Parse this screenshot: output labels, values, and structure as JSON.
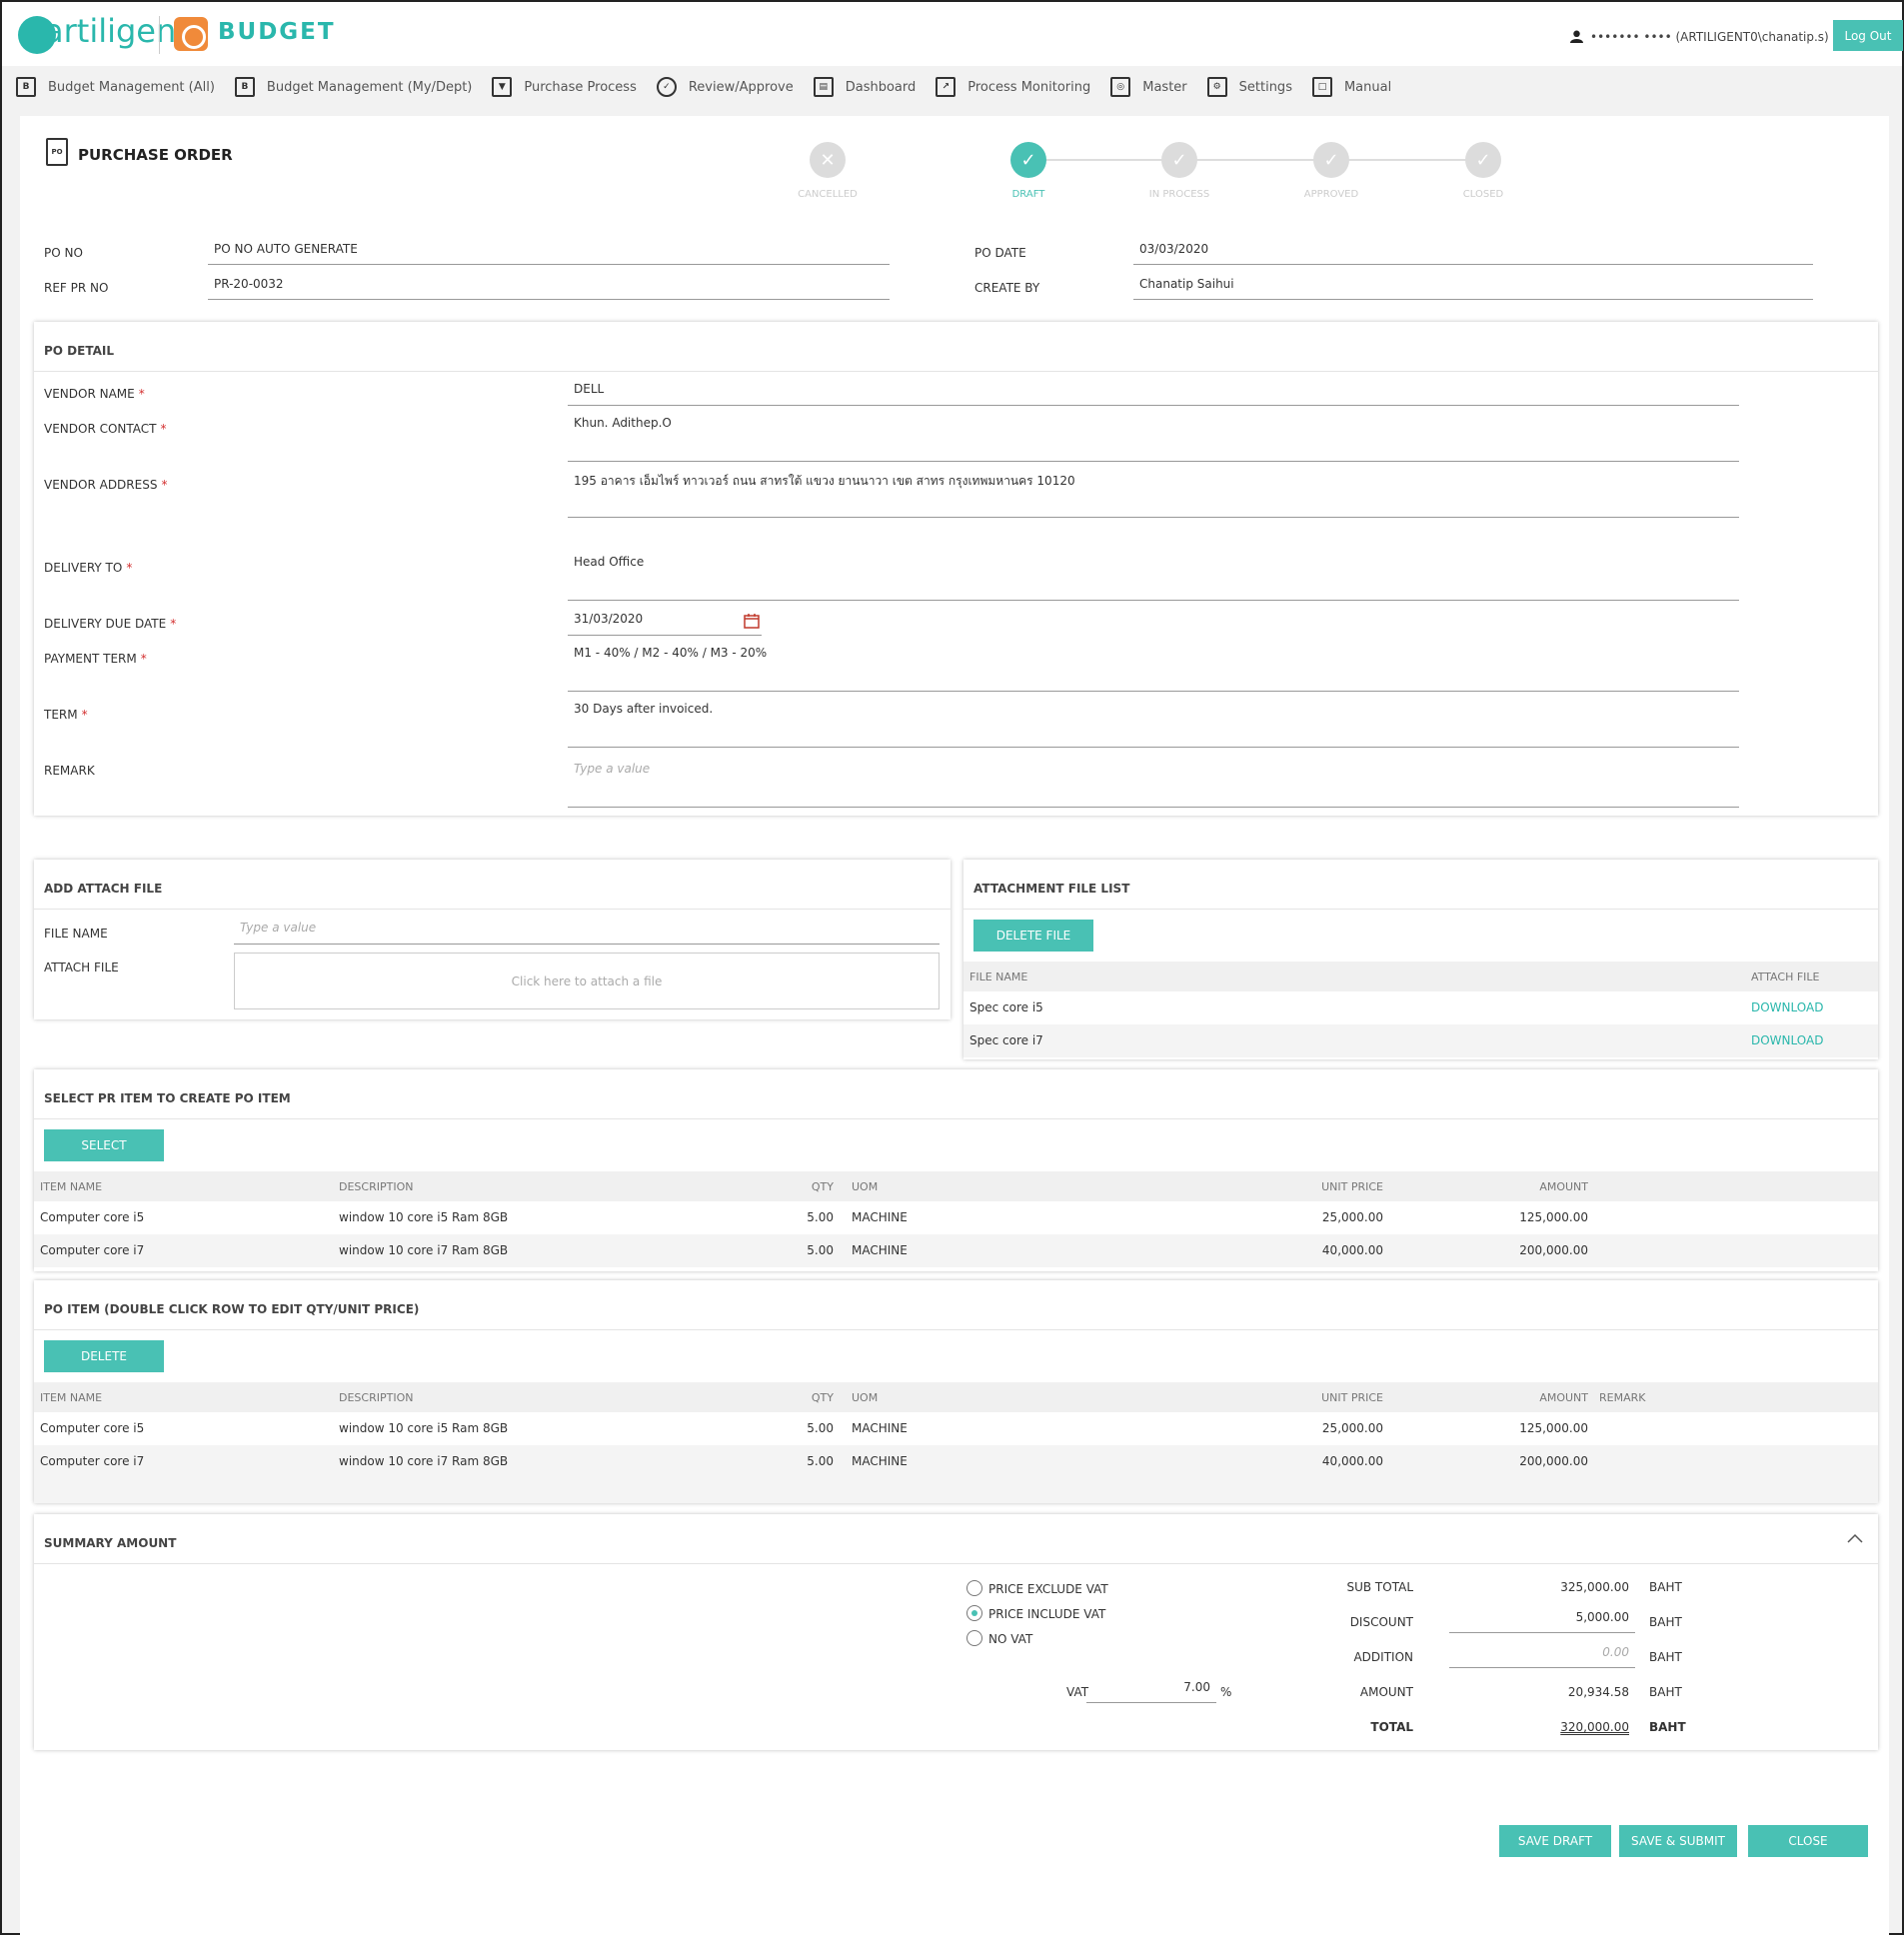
{
  "header": {
    "logo": "artiligent",
    "app": "BUDGET",
    "user": "••••••• •••• (ARTILIGENT0\\chanatip.s)",
    "logout": "Log Out"
  },
  "menu": [
    {
      "label": "Budget Management (All)",
      "icon": "B"
    },
    {
      "label": "Budget Management (My/Dept)",
      "icon": "B"
    },
    {
      "label": "Purchase Process",
      "icon": "▼"
    },
    {
      "label": "Review/Approve",
      "icon": "✓"
    },
    {
      "label": "Dashboard",
      "icon": "▤"
    },
    {
      "label": "Process Monitoring",
      "icon": "↗"
    },
    {
      "label": "Master",
      "icon": "◎"
    },
    {
      "label": "Settings",
      "icon": "⚙"
    },
    {
      "label": "Manual",
      "icon": "□"
    }
  ],
  "page": {
    "icon": "PO",
    "title": "PURCHASE ORDER"
  },
  "steps": [
    "CANCELLED",
    "DRAFT",
    "IN PROCESS",
    "APPROVED",
    "CLOSED"
  ],
  "steps_active": "DRAFT",
  "head": {
    "po_no_label": "PO NO",
    "po_no": "PO NO AUTO GENERATE",
    "ref_pr_label": "REF PR NO",
    "ref_pr": "PR-20-0032",
    "po_date_label": "PO DATE",
    "po_date": "03/03/2020",
    "create_by_label": "CREATE BY",
    "create_by": "Chanatip Saihui"
  },
  "detail": {
    "title": "PO DETAIL",
    "vendor_name_label": "VENDOR NAME",
    "vendor_name": "DELL",
    "vendor_contact_label": "VENDOR CONTACT",
    "vendor_contact": "Khun. Adithep.O",
    "vendor_address_label": "VENDOR ADDRESS",
    "vendor_address": "195 อาคาร เอ็มไพร์ ทาวเวอร์ ถนน สาทรใต้ แขวง ยานนาวา เขต สาทร กรุงเทพมหานคร 10120",
    "delivery_to_label": "DELIVERY TO",
    "delivery_to": "Head Office",
    "due_date_label": "DELIVERY DUE DATE",
    "due_date": "31/03/2020",
    "payment_term_label": "PAYMENT TERM",
    "payment_term": "M1 - 40% / M2 - 40% / M3 - 20%",
    "term_label": "TERM",
    "term": "30 Days after invoiced.",
    "remark_label": "REMARK",
    "remark_placeholder": "Type a value"
  },
  "attach": {
    "title": "ADD ATTACH FILE",
    "file_name_label": "FILE NAME",
    "file_name_placeholder": "Type a value",
    "attach_label": "ATTACH FILE",
    "drop_text": "Click here to attach a file"
  },
  "files": {
    "title": "ATTACHMENT FILE LIST",
    "delete_btn": "DELETE FILE",
    "col_name": "FILE NAME",
    "col_attach": "ATTACH FILE",
    "rows": [
      {
        "name": "Spec core i5",
        "link": "DOWNLOAD"
      },
      {
        "name": "Spec core i7",
        "link": "DOWNLOAD"
      }
    ]
  },
  "pr_items": {
    "title": "SELECT PR ITEM TO CREATE PO ITEM",
    "button": "SELECT",
    "cols": {
      "item": "ITEM NAME",
      "desc": "DESCRIPTION",
      "qty": "QTY",
      "uom": "UOM",
      "unit": "UNIT PRICE",
      "amount": "AMOUNT"
    },
    "rows": [
      {
        "item": "Computer core i5",
        "desc": "window 10 core i5 Ram 8GB",
        "qty": "5.00",
        "uom": "MACHINE",
        "unit": "25,000.00",
        "amount": "125,000.00"
      },
      {
        "item": "Computer core i7",
        "desc": "window 10 core i7 Ram 8GB",
        "qty": "5.00",
        "uom": "MACHINE",
        "unit": "40,000.00",
        "amount": "200,000.00"
      }
    ]
  },
  "po_items": {
    "title": "PO ITEM (DOUBLE CLICK ROW TO EDIT QTY/UNIT PRICE)",
    "button": "DELETE",
    "cols": {
      "item": "ITEM NAME",
      "desc": "DESCRIPTION",
      "qty": "QTY",
      "uom": "UOM",
      "unit": "UNIT PRICE",
      "amount": "AMOUNT",
      "remark": "REMARK"
    },
    "rows": [
      {
        "item": "Computer core i5",
        "desc": "window 10 core i5 Ram 8GB",
        "qty": "5.00",
        "uom": "MACHINE",
        "unit": "25,000.00",
        "amount": "125,000.00"
      },
      {
        "item": "Computer core i7",
        "desc": "window 10 core i7 Ram 8GB",
        "qty": "5.00",
        "uom": "MACHINE",
        "unit": "40,000.00",
        "amount": "200,000.00"
      }
    ]
  },
  "summary": {
    "title": "SUMMARY AMOUNT",
    "vat_options": [
      "PRICE EXCLUDE VAT",
      "PRICE INCLUDE VAT",
      "NO VAT"
    ],
    "vat_selected": "PRICE INCLUDE VAT",
    "vat_label": "VAT",
    "vat_value": "7.00",
    "vat_unit": "%",
    "subtotal_label": "SUB TOTAL",
    "subtotal": "325,000.00",
    "discount_label": "DISCOUNT",
    "discount": "5,000.00",
    "addition_label": "ADDITION",
    "addition": "0.00",
    "amount_label": "AMOUNT",
    "amount": "20,934.58",
    "total_label": "TOTAL",
    "total": "320,000.00",
    "currency": "BAHT"
  },
  "actions": {
    "save_draft": "SAVE DRAFT",
    "save_submit": "SAVE & SUBMIT",
    "close": "CLOSE"
  },
  "colors": {
    "accent": "#49c1b4",
    "required": "#d32f2f"
  }
}
